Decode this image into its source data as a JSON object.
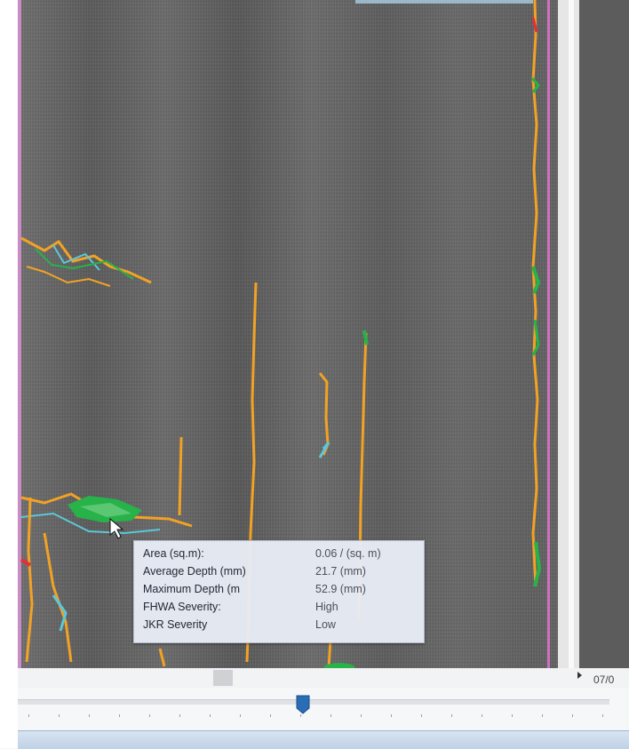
{
  "tooltip": {
    "rows": [
      {
        "label": "Area (sq.m):",
        "value": "0.06 / (sq. m)"
      },
      {
        "label": "Average Depth (mm)",
        "value": "21.7 (mm)"
      },
      {
        "label": "Maximum Depth (m",
        "value": "52.9 (mm)"
      },
      {
        "label": "FHWA Severity:",
        "value": "High"
      },
      {
        "label": "JKR Severity",
        "value": "Low"
      }
    ]
  },
  "timeline": {
    "date_label": "07/0",
    "position_fraction": 0.47
  },
  "colors": {
    "crack_orange": "#f2a224",
    "crack_green": "#27b24a",
    "crack_cyan": "#5cc7d8",
    "lane_pink": "#d070c0",
    "handle_blue": "#2a6db5"
  },
  "icons": {
    "cursor": "pointer-cursor-icon",
    "handle": "timeline-handle-icon",
    "next": "next-arrow-icon"
  }
}
